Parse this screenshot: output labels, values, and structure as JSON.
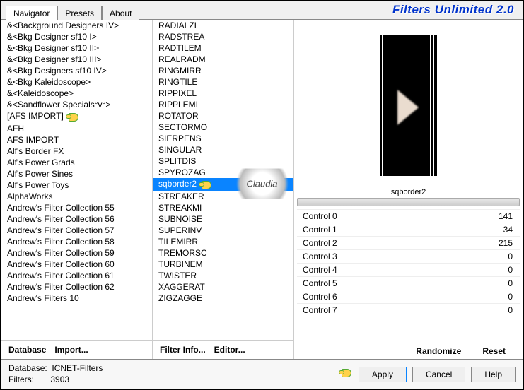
{
  "header": {
    "title": "Filters Unlimited 2.0"
  },
  "tabs": [
    "Navigator",
    "Presets",
    "About"
  ],
  "active_tab": 0,
  "categories": [
    "&<Background Designers IV>",
    "&<Bkg Designer sf10 I>",
    "&<Bkg Designer sf10 II>",
    "&<Bkg Designer sf10 III>",
    "&<Bkg Designers sf10 IV>",
    "&<Bkg Kaleidoscope>",
    "&<Kaleidoscope>",
    "&<Sandflower Specials°v°>",
    "[AFS IMPORT]",
    "AFH",
    "AFS IMPORT",
    "Alf's Border FX",
    "Alf's Power Grads",
    "Alf's Power Sines",
    "Alf's Power Toys",
    "AlphaWorks",
    "Andrew's Filter Collection 55",
    "Andrew's Filter Collection 56",
    "Andrew's Filter Collection 57",
    "Andrew's Filter Collection 58",
    "Andrew's Filter Collection 59",
    "Andrew's Filter Collection 60",
    "Andrew's Filter Collection 61",
    "Andrew's Filter Collection 62",
    "Andrew's Filters 10"
  ],
  "category_pointer_index": 8,
  "filters": [
    "RADIALZI",
    "RADSTREA",
    "RADTILEM",
    "REALRADM",
    "RINGMIRR",
    "RINGTILE",
    "RIPPIXEL",
    "RIPPLEMI",
    "ROTATOR",
    "SECTORMO",
    "SIERPENS",
    "SINGULAR",
    "SPLITDIS",
    "SPYROZAG",
    "sqborder2",
    "STREAKER",
    "STREAKMI",
    "SUBNOISE",
    "SUPERINV",
    "TILEMIRR",
    "TREMORSC",
    "TURBINEM",
    "TWISTER",
    "XAGGERAT",
    "ZIGZAGGE"
  ],
  "selected_filter_index": 14,
  "cat_buttons": {
    "database": "Database",
    "import": "Import..."
  },
  "fil_buttons": {
    "info": "Filter Info...",
    "editor": "Editor..."
  },
  "preview": {
    "label": "sqborder2"
  },
  "controls": [
    {
      "label": "Control 0",
      "value": 141
    },
    {
      "label": "Control 1",
      "value": 34
    },
    {
      "label": "Control 2",
      "value": 215
    },
    {
      "label": "Control 3",
      "value": 0
    },
    {
      "label": "Control 4",
      "value": 0
    },
    {
      "label": "Control 5",
      "value": 0
    },
    {
      "label": "Control 6",
      "value": 0
    },
    {
      "label": "Control 7",
      "value": 0
    }
  ],
  "prev_buttons": {
    "randomize": "Randomize",
    "reset": "Reset"
  },
  "footer": {
    "db_label": "Database:",
    "db_value": "ICNET-Filters",
    "flt_label": "Filters:",
    "flt_value": "3903",
    "apply": "Apply",
    "cancel": "Cancel",
    "help": "Help"
  },
  "badge": "Claudia"
}
